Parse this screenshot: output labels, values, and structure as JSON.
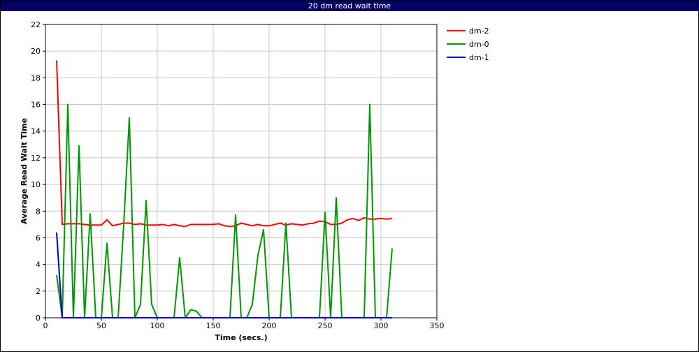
{
  "title": "20 dm read wait time",
  "chart_data": {
    "type": "line",
    "title": "20 dm read wait time",
    "xlabel": "Time (secs.)",
    "ylabel": "Average Read Wait Time",
    "xlim": [
      0,
      350
    ],
    "ylim": [
      0,
      22
    ],
    "xticks": [
      "0",
      "50",
      "100",
      "150",
      "200",
      "250",
      "300",
      "350"
    ],
    "yticks": [
      "0",
      "2",
      "4",
      "6",
      "8",
      "10",
      "12",
      "14",
      "16",
      "18",
      "20",
      "22"
    ],
    "grid": true,
    "legend_position": "right",
    "series": [
      {
        "name": "dm-2",
        "color": "#ff0000",
        "x": [
          10,
          15,
          20,
          25,
          30,
          35,
          40,
          45,
          50,
          55,
          60,
          65,
          70,
          75,
          80,
          85,
          90,
          95,
          100,
          105,
          110,
          115,
          120,
          125,
          130,
          135,
          140,
          145,
          150,
          155,
          160,
          165,
          170,
          175,
          180,
          185,
          190,
          195,
          200,
          205,
          210,
          215,
          220,
          225,
          230,
          235,
          240,
          245,
          250,
          255,
          260,
          265,
          270,
          275,
          280,
          285,
          290,
          295,
          300,
          305,
          310
        ],
        "y": [
          19.3,
          7.0,
          7.05,
          7.05,
          7.05,
          7.0,
          6.95,
          6.95,
          6.95,
          7.35,
          6.9,
          7.0,
          7.1,
          7.1,
          7.0,
          7.05,
          6.95,
          6.95,
          6.95,
          7.0,
          6.9,
          7.0,
          6.9,
          6.85,
          7.0,
          7.0,
          7.0,
          7.0,
          7.0,
          7.05,
          6.9,
          6.85,
          6.9,
          7.1,
          7.0,
          6.9,
          7.0,
          6.9,
          6.9,
          7.0,
          7.1,
          6.95,
          7.05,
          7.0,
          6.95,
          7.05,
          7.1,
          7.25,
          7.2,
          7.0,
          7.0,
          7.1,
          7.35,
          7.45,
          7.3,
          7.5,
          7.4,
          7.4,
          7.45,
          7.4,
          7.45
        ]
      },
      {
        "name": "dm-0",
        "color": "#009900",
        "x": [
          10,
          15,
          20,
          25,
          30,
          35,
          40,
          45,
          50,
          55,
          60,
          65,
          70,
          75,
          80,
          85,
          90,
          95,
          100,
          105,
          110,
          115,
          120,
          125,
          130,
          135,
          140,
          145,
          150,
          155,
          160,
          165,
          170,
          175,
          180,
          185,
          190,
          195,
          200,
          205,
          210,
          215,
          220,
          225,
          230,
          235,
          240,
          245,
          250,
          255,
          260,
          265,
          270,
          275,
          280,
          285,
          290,
          295,
          300,
          305,
          310
        ],
        "y": [
          3.2,
          0,
          16.0,
          0,
          12.9,
          0,
          7.8,
          0,
          0,
          5.6,
          0,
          0,
          7.0,
          15.0,
          0,
          1.0,
          8.8,
          1.0,
          0,
          0,
          0,
          0,
          4.5,
          0,
          0.6,
          0.5,
          0,
          0,
          0,
          0,
          0,
          0,
          7.7,
          0,
          0,
          1.0,
          4.7,
          6.6,
          0,
          0,
          0,
          7.1,
          0,
          0,
          0,
          0,
          0,
          0,
          7.9,
          0,
          9.0,
          0,
          0,
          0,
          0,
          0,
          16.0,
          0,
          0,
          0,
          5.2
        ]
      },
      {
        "name": "dm-1",
        "color": "#0000cc",
        "x": [
          10,
          15,
          20,
          25,
          30,
          35,
          40,
          45,
          50,
          55,
          60,
          65,
          70,
          75,
          80,
          85,
          90,
          95,
          100,
          105,
          110,
          115,
          120,
          125,
          130,
          135,
          140,
          145,
          150,
          155,
          160,
          165,
          170,
          175,
          180,
          185,
          190,
          195,
          200,
          205,
          210,
          215,
          220,
          225,
          230,
          235,
          240,
          245,
          250,
          255,
          260,
          265,
          270,
          275,
          280,
          285,
          290,
          295,
          300,
          305,
          310
        ],
        "y": [
          6.4,
          0,
          0,
          0,
          0,
          0,
          0,
          0,
          0,
          0,
          0,
          0,
          0,
          0,
          0,
          0,
          0,
          0,
          0,
          0,
          0,
          0,
          0,
          0,
          0,
          0,
          0,
          0,
          0,
          0,
          0,
          0,
          0,
          0,
          0,
          0,
          0,
          0,
          0,
          0,
          0,
          0,
          0,
          0,
          0,
          0,
          0,
          0,
          0,
          0,
          0,
          0,
          0,
          0,
          0,
          0,
          0,
          0,
          0,
          0,
          0
        ]
      }
    ]
  }
}
